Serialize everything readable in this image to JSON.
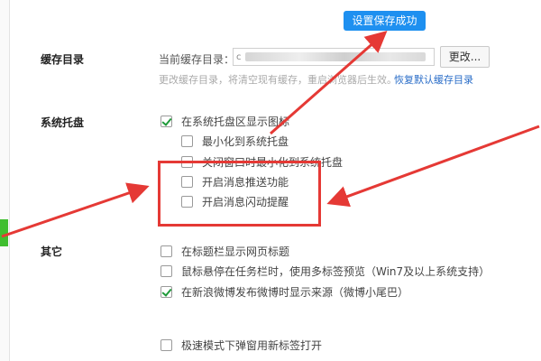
{
  "toast": {
    "text": "设置保存成功"
  },
  "cache": {
    "title": "缓存目录",
    "current_label": "当前缓存目录：",
    "path_start": "c",
    "path_mid": "apps",
    "change_button": "更改...",
    "hint": "更改缓存目录，将清空现有缓存，重启浏览器后生效。",
    "restore_link": "恢复默认缓存目录"
  },
  "tray": {
    "title": "系统托盘",
    "options": [
      {
        "label": "在系统托盘区显示图标",
        "checked": true
      },
      {
        "label": "最小化到系统托盘",
        "checked": false
      },
      {
        "label": "关闭窗口时最小化到系统托盘",
        "checked": false
      },
      {
        "label": "开启消息推送功能",
        "checked": false
      },
      {
        "label": "开启消息闪动提醒",
        "checked": false
      }
    ]
  },
  "other": {
    "title": "其它",
    "options": [
      {
        "label": "在标题栏显示网页标题",
        "checked": false
      },
      {
        "label": "鼠标悬停在任务栏时，使用多标签预览（Win7及以上系统支持）",
        "checked": false
      },
      {
        "label": "在新浪微博发布微博时显示来源（微博小尾巴）",
        "checked": true
      },
      {
        "label": "极速模式下弹窗用新标签打开",
        "checked": false
      }
    ]
  },
  "colors": {
    "accent": "#1e90f0",
    "annotation": "#e53935",
    "check": "#1f9a3a"
  }
}
